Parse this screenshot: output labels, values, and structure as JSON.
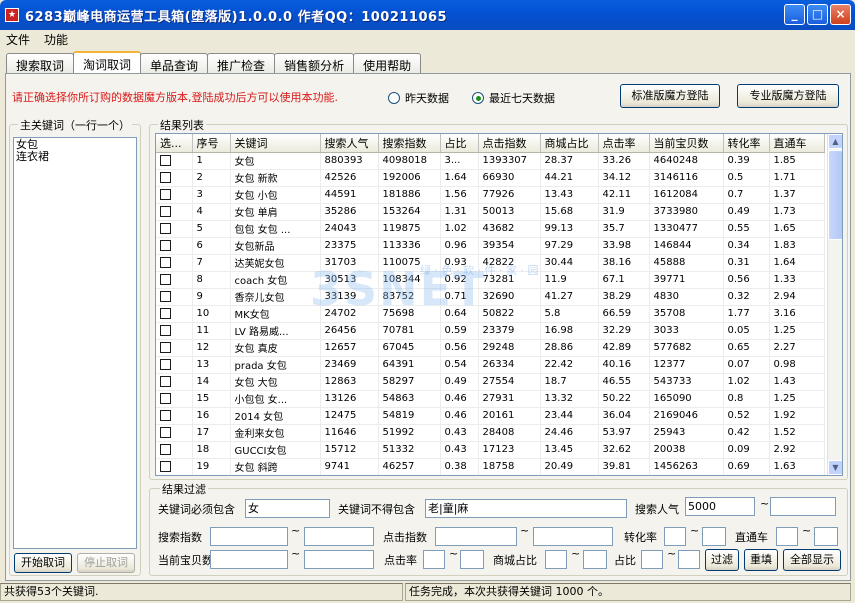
{
  "window": {
    "icon": "app-icon",
    "title": "6283巅峰电商运营工具箱(堕落版)1.0.0.0 作者QQ：100211065"
  },
  "menu": [
    "文件",
    "功能"
  ],
  "tabs": [
    {
      "label": "搜索取词",
      "active": false
    },
    {
      "label": "淘词取词",
      "active": true
    },
    {
      "label": "单品查询",
      "active": false
    },
    {
      "label": "推广检查",
      "active": false
    },
    {
      "label": "销售额分析",
      "active": false
    },
    {
      "label": "使用帮助",
      "active": false
    }
  ],
  "notice": "请正确选择你所订购的数据魔方版本,登陆成功后方可以使用本功能.",
  "radios": {
    "yesterday": "昨天数据",
    "last7": "最近七天数据",
    "selected": "last7"
  },
  "buttons": {
    "standard_login": "标准版魔方登陆",
    "pro_login": "专业版魔方登陆",
    "start": "开始取词",
    "stop": "停止取词",
    "filter": "过滤",
    "reset": "重填",
    "show_all": "全部显示"
  },
  "keywords_panel": {
    "legend": "主关键词（一行一个）",
    "lines": [
      "女包",
      "连衣裙"
    ]
  },
  "results": {
    "legend": "结果列表",
    "columns": [
      "选...",
      "序号",
      "关键词",
      "搜索人气",
      "搜索指数",
      "占比",
      "点击指数",
      "商城占比",
      "点击率",
      "当前宝贝数",
      "转化率",
      "直通车"
    ],
    "rows": [
      [
        "1",
        "女包",
        "880393",
        "4098018",
        "3...",
        "1393307",
        "28.37",
        "33.26",
        "4640248",
        "0.39",
        "1.85"
      ],
      [
        "2",
        "女包 新款",
        "42526",
        "192006",
        "1.64",
        "66930",
        "44.21",
        "34.12",
        "3146116",
        "0.5",
        "1.71"
      ],
      [
        "3",
        "女包 小包",
        "44591",
        "181886",
        "1.56",
        "77926",
        "13.43",
        "42.11",
        "1612084",
        "0.7",
        "1.37"
      ],
      [
        "4",
        "女包 单肩",
        "35286",
        "153264",
        "1.31",
        "50013",
        "15.68",
        "31.9",
        "3733980",
        "0.49",
        "1.73"
      ],
      [
        "5",
        "包包 女包 ...",
        "24043",
        "119875",
        "1.02",
        "43682",
        "99.13",
        "35.7",
        "1330477",
        "0.55",
        "1.65"
      ],
      [
        "6",
        "女包新品",
        "23375",
        "113336",
        "0.96",
        "39354",
        "97.29",
        "33.98",
        "146844",
        "0.34",
        "1.83"
      ],
      [
        "7",
        "达芙妮女包",
        "31703",
        "110075",
        "0.93",
        "42822",
        "30.44",
        "38.16",
        "45888",
        "0.31",
        "1.64"
      ],
      [
        "8",
        "coach 女包",
        "30513",
        "108344",
        "0.92",
        "73281",
        "11.9",
        "67.1",
        "39771",
        "0.56",
        "1.33"
      ],
      [
        "9",
        "香奈儿女包",
        "33139",
        "83752",
        "0.71",
        "32690",
        "41.27",
        "38.29",
        "4830",
        "0.32",
        "2.94"
      ],
      [
        "10",
        "MK女包",
        "24702",
        "75698",
        "0.64",
        "50822",
        "5.8",
        "66.59",
        "35708",
        "1.77",
        "3.16"
      ],
      [
        "11",
        "LV 路易威...",
        "26456",
        "70781",
        "0.59",
        "23379",
        "16.98",
        "32.29",
        "3033",
        "0.05",
        "1.25"
      ],
      [
        "12",
        "女包 真皮",
        "12657",
        "67045",
        "0.56",
        "29248",
        "28.86",
        "42.89",
        "577682",
        "0.65",
        "2.27"
      ],
      [
        "13",
        "prada 女包",
        "23469",
        "64391",
        "0.54",
        "26334",
        "22.42",
        "40.16",
        "12377",
        "0.07",
        "0.98"
      ],
      [
        "14",
        "女包 大包",
        "12863",
        "58297",
        "0.49",
        "27554",
        "18.7",
        "46.55",
        "543733",
        "1.02",
        "1.43"
      ],
      [
        "15",
        "小包包 女...",
        "13126",
        "54863",
        "0.46",
        "27931",
        "13.32",
        "50.22",
        "165090",
        "0.8",
        "1.25"
      ],
      [
        "16",
        "2014 女包",
        "12475",
        "54819",
        "0.46",
        "20161",
        "23.44",
        "36.04",
        "2169046",
        "0.52",
        "1.92"
      ],
      [
        "17",
        "金利来女包",
        "11646",
        "51992",
        "0.43",
        "28408",
        "24.46",
        "53.97",
        "25943",
        "0.42",
        "1.52"
      ],
      [
        "18",
        "GUCCI女包",
        "15712",
        "51332",
        "0.43",
        "17123",
        "13.45",
        "32.62",
        "20038",
        "0.09",
        "2.92"
      ],
      [
        "19",
        "女包 斜跨",
        "9741",
        "46257",
        "0.38",
        "18758",
        "20.49",
        "39.81",
        "1456263",
        "0.69",
        "1.63"
      ]
    ]
  },
  "filter": {
    "legend": "结果过滤",
    "must_include_label": "关键词必须包含",
    "must_include_value": "女",
    "must_exclude_label": "关键词不得包含",
    "must_exclude_value": "老|童|麻",
    "search_pop_label": "搜索人气",
    "search_pop_value": "5000",
    "search_index_label": "搜索指数",
    "click_index_label": "点击指数",
    "conv_label": "转化率",
    "ztc_label": "直通车",
    "items_label": "当前宝贝数",
    "ctr_label": "点击率",
    "mall_label": "商城占比",
    "share_label": "占比",
    "tilde": "~"
  },
  "watermark": {
    "text": "3SNET",
    "sub": "绿 · 色 · 软 · 件 · 家 · 园"
  },
  "status": {
    "left": "共获得53个关键词.",
    "right": "任务完成，本次共获得关键词 1000 个。"
  },
  "colors": {
    "title_bar": "#0a5fde",
    "notice": "#d81818"
  }
}
